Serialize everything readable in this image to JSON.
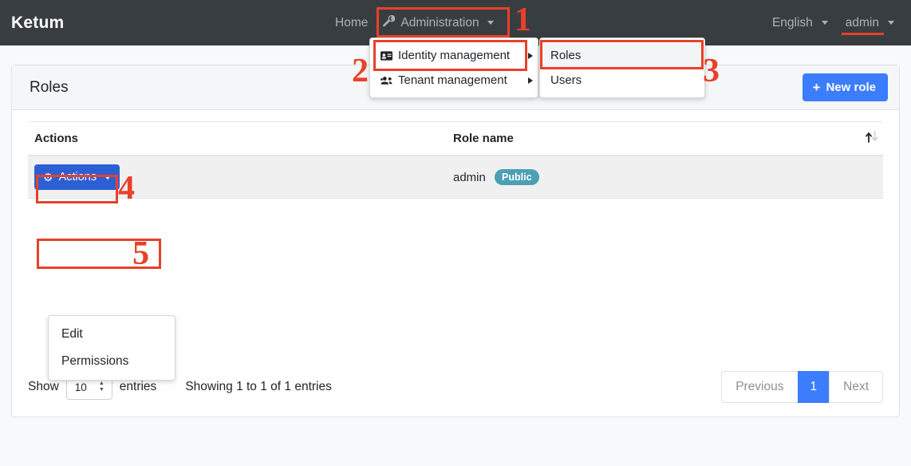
{
  "navbar": {
    "brand": "Ketum",
    "home_label": "Home",
    "administration_label": "Administration",
    "administration_icon": "wrench-icon",
    "language_label": "English",
    "user_label": "admin"
  },
  "admin_menu": {
    "items": [
      {
        "label": "Identity management",
        "icon": "id-card-icon",
        "has_submenu": true
      },
      {
        "label": "Tenant management",
        "icon": "users-group-icon",
        "has_submenu": true
      }
    ]
  },
  "identity_submenu": {
    "items": [
      {
        "label": "Roles",
        "selected": true
      },
      {
        "label": "Users",
        "selected": false
      }
    ]
  },
  "card": {
    "title": "Roles",
    "new_role_button": "New role",
    "new_role_icon": "plus-icon"
  },
  "table": {
    "headers": [
      "Actions",
      "Role name",
      ""
    ],
    "sort_icon": "sort-arrows-icon",
    "rows": [
      {
        "actions_button": "Actions",
        "actions_icon": "gear-icon",
        "role_name": "admin",
        "badge": "Public"
      }
    ]
  },
  "actions_menu": {
    "items": [
      {
        "label": "Edit"
      },
      {
        "label": "Permissions"
      }
    ]
  },
  "footer": {
    "show_label": "Show",
    "page_length": "10",
    "entries_label": "entries",
    "showing_text": "Showing 1 to 1 of 1 entries",
    "pagination": {
      "previous": "Previous",
      "pages": [
        "1"
      ],
      "next": "Next"
    }
  },
  "annotations": {
    "numbers": [
      "1",
      "2",
      "3",
      "4",
      "5"
    ],
    "color": "#e8412a"
  },
  "colors": {
    "navbar_bg": "#383d41",
    "page_bg": "#f8f9fa",
    "primary_blue": "#3b7dfc",
    "actions_blue": "#2d5fd4",
    "badge_teal": "#4ca0b4",
    "annotation_red": "#e8412a"
  }
}
